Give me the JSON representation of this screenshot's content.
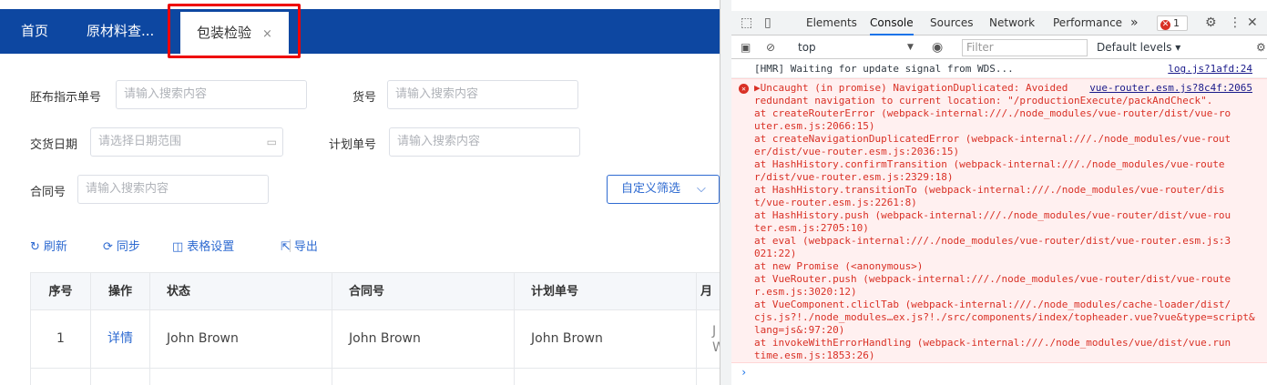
{
  "tabs": {
    "home": "首页",
    "materials": "原材料查...",
    "packaging": "包装检验",
    "close": "×"
  },
  "form": {
    "dye_order_label": "胚布指示单号",
    "dye_order_placeholder": "请输入搜索内容",
    "item_no_label": "货号",
    "item_no_placeholder": "请输入搜索内容",
    "delivery_date_label": "交货日期",
    "delivery_date_placeholder": "请选择日期范围",
    "plan_no_label": "计划单号",
    "plan_no_placeholder": "请输入搜索内容",
    "contract_no_label": "合同号",
    "contract_no_placeholder": "请输入搜索内容",
    "custom_filter": "自定义筛选"
  },
  "toolbar": {
    "refresh": "刷新",
    "sync": "同步",
    "table_settings": "表格设置",
    "export": "导出"
  },
  "table": {
    "headers": [
      "序号",
      "操作",
      "状态",
      "合同号",
      "计划单号",
      "月"
    ],
    "rows": [
      {
        "index": "1",
        "action": "详情",
        "status": "John Brown",
        "contract": "John Brown",
        "plan": "John Brown",
        "extra_top": "J",
        "extra_bottom": "W"
      }
    ]
  },
  "devtools": {
    "tabs": [
      "Elements",
      "Console",
      "Sources",
      "Network",
      "Performance"
    ],
    "more": "»",
    "error_count": "1",
    "context": "top",
    "filter_placeholder": "Filter",
    "levels": "Default levels ▾",
    "hmr_message": "[HMR] Waiting for update signal from WDS...",
    "hmr_source": "log.js?1afd:24",
    "error_lines": [
      "▶Uncaught (in promise) NavigationDuplicated: Avoided",
      "redundant navigation to current location: \"/productionExecute/packAndCheck\".",
      "    at createRouterError (webpack-internal:///./node_modules/vue-router/dist/vue-ro",
      "uter.esm.js:2066:15)",
      "    at createNavigationDuplicatedError (webpack-internal:///./node_modules/vue-rout",
      "er/dist/vue-router.esm.js:2036:15)",
      "    at HashHistory.confirmTransition (webpack-internal:///./node_modules/vue-route",
      "r/dist/vue-router.esm.js:2329:18)",
      "    at HashHistory.transitionTo (webpack-internal:///./node_modules/vue-router/dis",
      "t/vue-router.esm.js:2261:8)",
      "    at HashHistory.push (webpack-internal:///./node_modules/vue-router/dist/vue-rou",
      "ter.esm.js:2705:10)",
      "    at eval (webpack-internal:///./node_modules/vue-router/dist/vue-router.esm.js:3",
      "021:22)",
      "    at new Promise (<anonymous>)",
      "    at VueRouter.push (webpack-internal:///./node_modules/vue-router/dist/vue-route",
      "r.esm.js:3020:12)",
      "    at VueComponent.cliclTab (webpack-internal:///./node_modules/cache-loader/dist/",
      "cjs.js?!./node_modules…ex.js?!./src/components/index/topheader.vue?vue&type=script&",
      "lang=js&:97:20)",
      "    at invokeWithErrorHandling (webpack-internal:///./node_modules/vue/dist/vue.run",
      "time.esm.js:1853:26)"
    ],
    "error_source": "vue-router.esm.js?8c4f:2065",
    "prompt": "›"
  }
}
